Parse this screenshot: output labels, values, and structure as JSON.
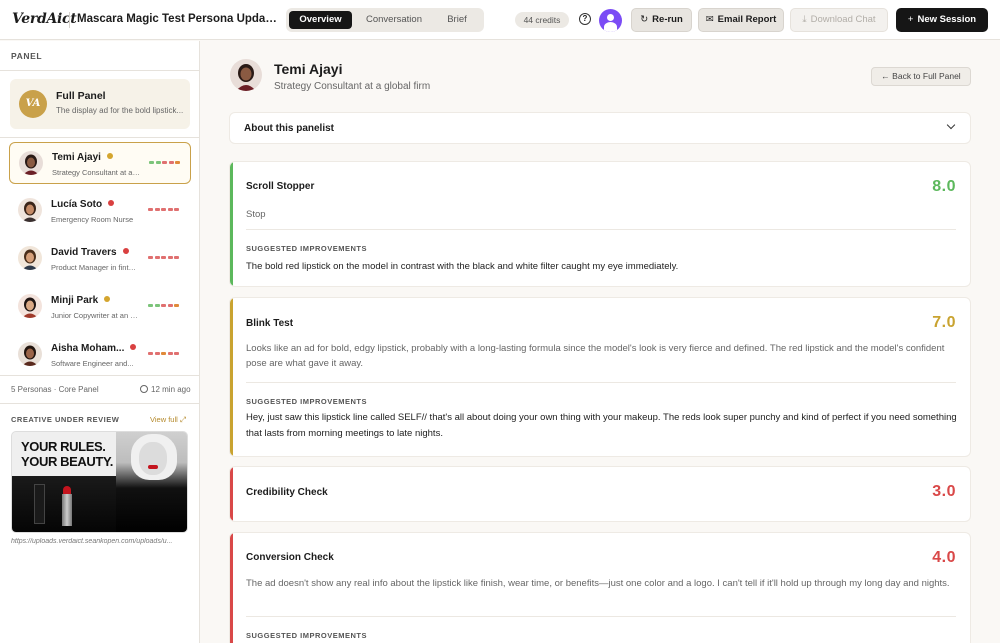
{
  "app": {
    "logo": "VerdAict",
    "session_title": "Mascara Magic Test Persona Updat...",
    "tabs": [
      "Overview",
      "Conversation",
      "Brief"
    ],
    "active_tab": "Overview",
    "credits": "44 credits",
    "help_icon": "?",
    "buttons": {
      "rerun": "Re-run",
      "email": "Email Report",
      "download": "Download Chat",
      "new_session": "New Session"
    }
  },
  "sidebar": {
    "panel_label": "PANEL",
    "full_panel": {
      "badge": "VA",
      "title": "Full Panel",
      "subtitle": "The display ad for the bold lipstick..."
    },
    "personas": [
      {
        "name": "Temi Ajayi",
        "role": "Strategy Consultant at a global firm",
        "status": "#d4a52e",
        "active": true,
        "bars": [
          "#7cc47a",
          "#7cc47a",
          "#e07070",
          "#e07070",
          "#e08a3a"
        ]
      },
      {
        "name": "Lucía Soto",
        "role": "Emergency Room Nurse",
        "status": "#d94040",
        "active": false,
        "bars": [
          "#e07070",
          "#e07070",
          "#e07070",
          "#e07070",
          "#e07070"
        ]
      },
      {
        "name": "David Travers",
        "role": "Product Manager in fintech",
        "status": "#d94040",
        "active": false,
        "bars": [
          "#e07070",
          "#e07070",
          "#e07070",
          "#e07070",
          "#e07070"
        ]
      },
      {
        "name": "Minji Park",
        "role": "Junior Copywriter at an agency",
        "status": "#d4a52e",
        "active": false,
        "bars": [
          "#7cc47a",
          "#7cc47a",
          "#e07070",
          "#e07070",
          "#e08a3a"
        ]
      },
      {
        "name": "Aisha Moham...",
        "role": "Software Engineer and...",
        "status": "#d94040",
        "active": false,
        "bars": [
          "#e07070",
          "#e07070",
          "#e08a3a",
          "#e07070",
          "#e07070"
        ]
      }
    ],
    "footer_left": "5 Personas · Core Panel",
    "footer_right": "12 min ago",
    "creative_label": "CREATIVE UNDER REVIEW",
    "view_full": "View full",
    "creative_headline_1": "YOUR RULES.",
    "creative_headline_2": "YOUR BEAUTY.",
    "creative_url": "https://uploads.verdaict.seankopen.com/uploads/u..."
  },
  "main": {
    "persona_name": "Temi Ajayi",
    "persona_role": "Strategy Consultant at a global firm",
    "back_label": "Back to Full Panel",
    "about_label": "About this panelist",
    "suggested_label": "SUGGESTED IMPROVEMENTS",
    "cards": [
      {
        "title": "Scroll Stopper",
        "score": "8.0",
        "color": "#5cb85c",
        "verdict": "Stop",
        "suggestion": "The bold red lipstick on the model in contrast with the black and white filter caught my eye immediately."
      },
      {
        "title": "Blink Test",
        "score": "7.0",
        "color": "#c9a330",
        "verdict": "Looks like an ad for bold, edgy lipstick, probably with a long-lasting formula since the model's look is very fierce and defined. The red lipstick and the model's confident pose are what gave it away.",
        "suggestion": "Hey, just saw this lipstick line called SELF// that's all about doing your own thing with your makeup. The reds look super punchy and kind of perfect if you need something that lasts from morning meetings to late nights."
      },
      {
        "title": "Credibility Check",
        "score": "3.0",
        "color": "#d94848"
      },
      {
        "title": "Conversion Check",
        "score": "4.0",
        "color": "#d94848",
        "verdict": "The ad doesn't show any real info about the lipstick like finish, wear time, or benefits—just one color and a logo. I can't tell if it'll hold up through my long day and nights."
      }
    ]
  }
}
